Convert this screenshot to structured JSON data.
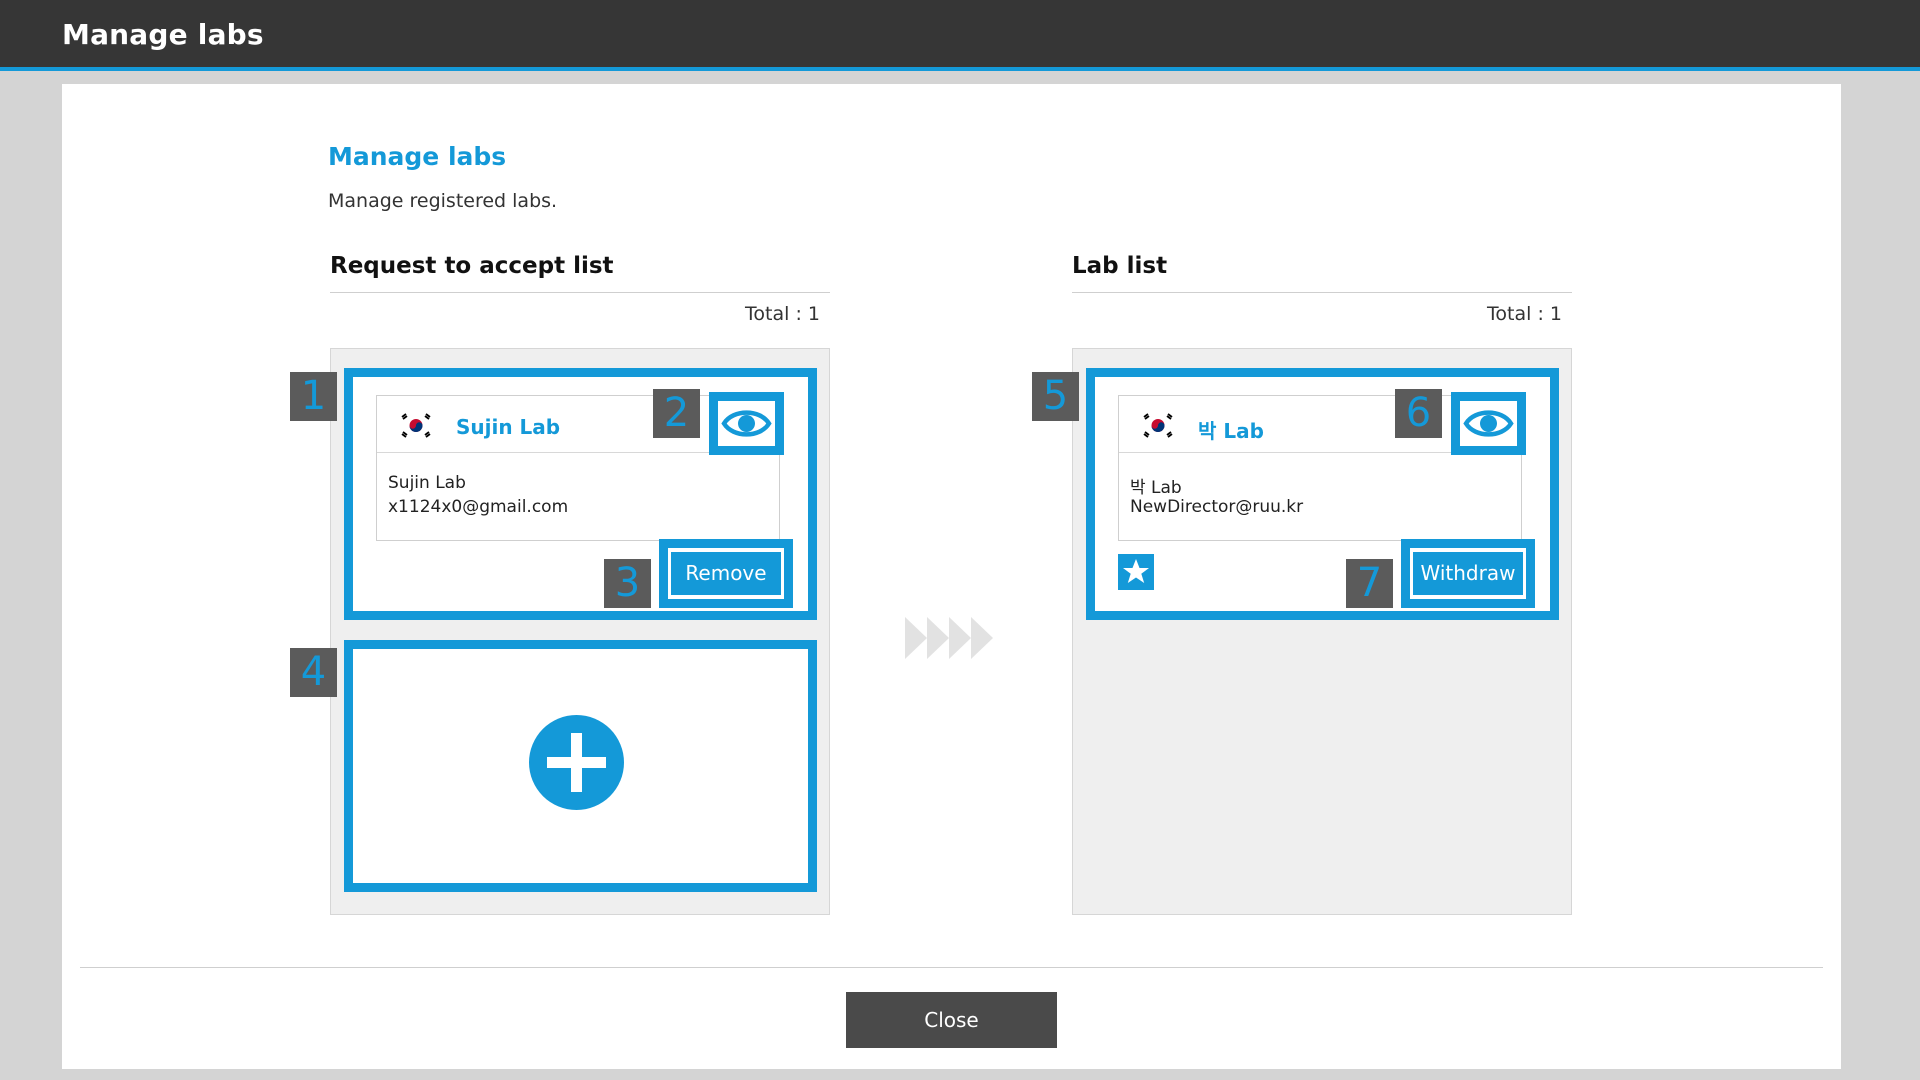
{
  "window": {
    "title": "Manage labs"
  },
  "header": {
    "title": "Manage labs",
    "description": "Manage registered labs."
  },
  "request_list": {
    "title": "Request to accept list",
    "total": "Total : 1",
    "card": {
      "name": "Sujin Lab",
      "line1": "Sujin Lab",
      "line2": "x1124x0@gmail.com",
      "button": "Remove"
    }
  },
  "lab_list": {
    "title": "Lab list",
    "total": "Total : 1",
    "card": {
      "name": "박 Lab",
      "line1": "박 Lab",
      "line2": "NewDirector@ruu.kr",
      "button": "Withdraw"
    }
  },
  "callouts": [
    "1",
    "2",
    "3",
    "4",
    "5",
    "6",
    "7"
  ],
  "footer": {
    "close": "Close"
  },
  "icons": {
    "view": "eye-icon",
    "add": "plus-circle-icon",
    "favorite": "star-icon",
    "flag": "korea-flag-icon",
    "arrows": "forward-arrows-icon"
  },
  "colors": {
    "accent": "#1499d8",
    "titlebar": "#363636",
    "badge": "#5b5b5b",
    "close_button": "#4a4a4a"
  }
}
